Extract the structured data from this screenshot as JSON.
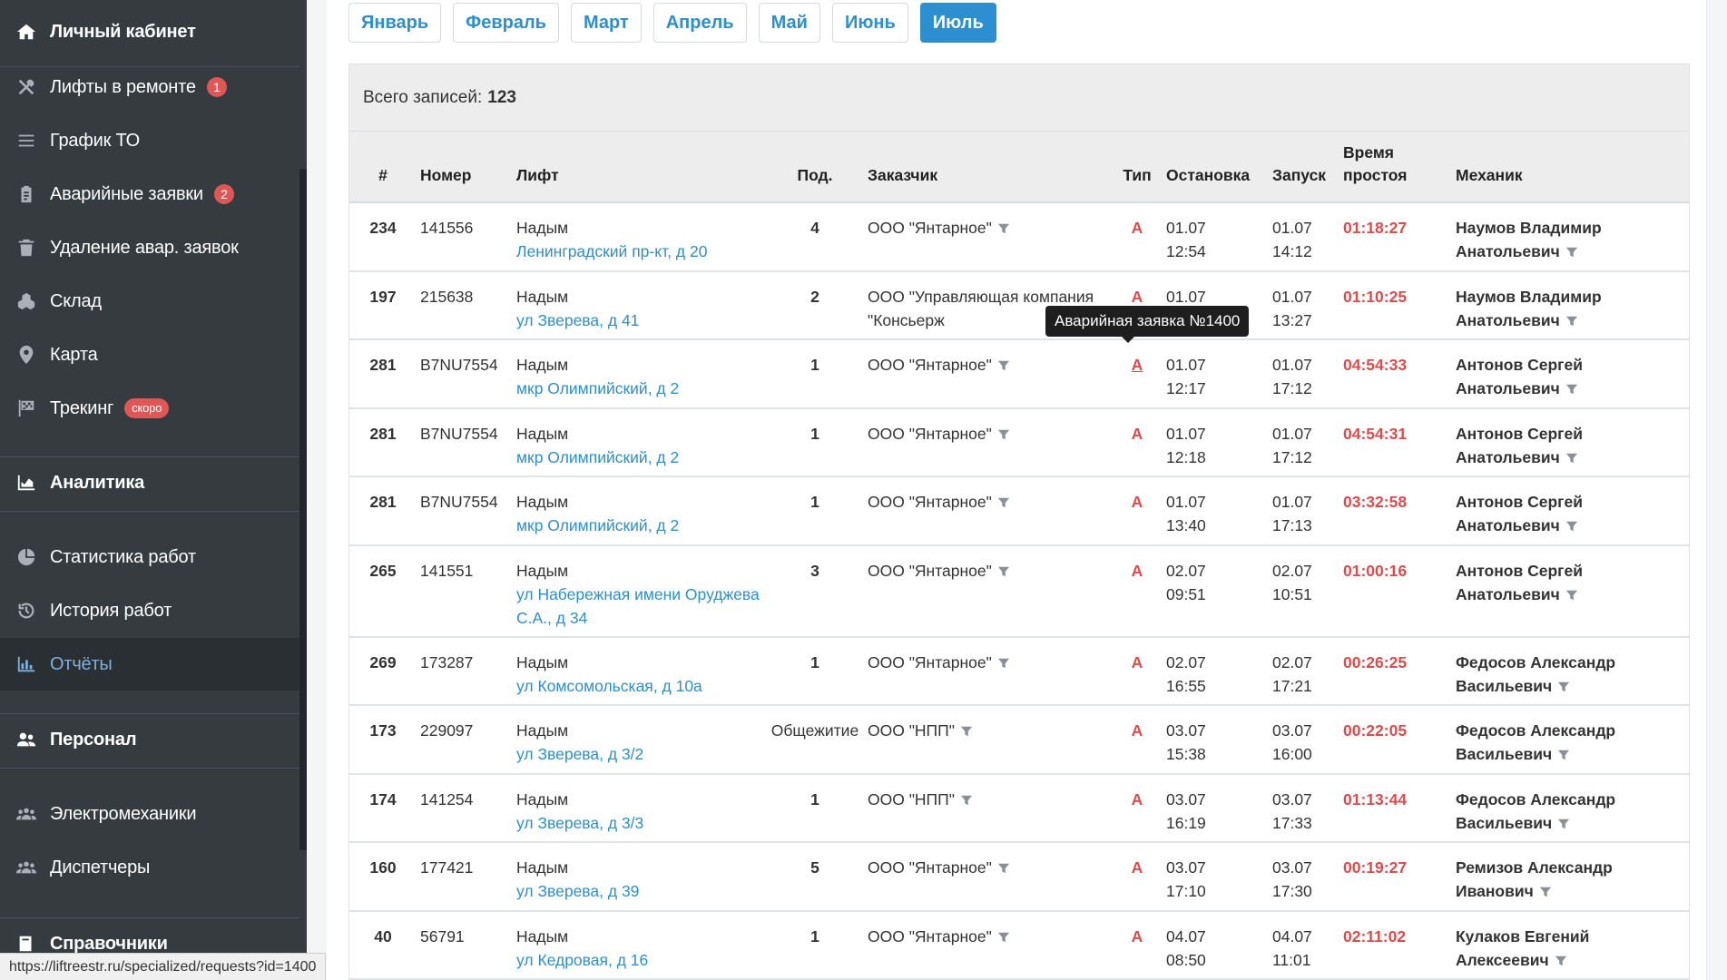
{
  "sidebar": {
    "title": "Личный кабинет",
    "items": [
      {
        "label": "Лифты в ремонте",
        "badge": "1"
      },
      {
        "label": "График ТО"
      },
      {
        "label": "Аварийные заявки",
        "badge": "2"
      },
      {
        "label": "Удаление авар. заявок"
      },
      {
        "label": "Склад"
      },
      {
        "label": "Карта"
      },
      {
        "label": "Трекинг",
        "badge": "скоро"
      }
    ],
    "analytics_header": "Аналитика",
    "analytics_items": [
      {
        "label": "Статистика работ"
      },
      {
        "label": "История работ"
      },
      {
        "label": "Отчёты"
      }
    ],
    "personnel_header": "Персонал",
    "personnel_items": [
      {
        "label": "Электромеханики"
      },
      {
        "label": "Диспетчеры"
      }
    ],
    "reference_header": "Справочники"
  },
  "months": [
    "Январь",
    "Февраль",
    "Март",
    "Апрель",
    "Май",
    "Июнь",
    "Июль"
  ],
  "active_month": "Июль",
  "summary": {
    "label": "Всего записей:",
    "count": "123"
  },
  "table": {
    "headers": {
      "idx": "#",
      "num": "Номер",
      "lift": "Лифт",
      "pod": "Под.",
      "cust": "Заказчик",
      "type": "Тип",
      "stop": "Остановка",
      "start": "Запуск",
      "down1": "Время",
      "down2": "простоя",
      "mech": "Механик"
    },
    "rows": [
      {
        "idx": "234",
        "num": "141556",
        "city": "Надым",
        "addr": "Ленинградский пр-кт, д 20",
        "pod": "4",
        "cust": "ООО \"Янтарное\"",
        "type": "А",
        "stop_d": "01.07",
        "stop_t": "12:54",
        "start_d": "01.07",
        "start_t": "14:12",
        "down": "01:18:27",
        "mech1": "Наумов Владимир",
        "mech2": "Анатольевич"
      },
      {
        "idx": "197",
        "num": "215638",
        "city": "Надым",
        "addr": "ул Зверева, д 41",
        "pod": "2",
        "cust": "ООО \"Управляющая компания \"Консьерж",
        "type": "А",
        "stop_d": "01.07",
        "stop_t": "",
        "start_d": "01.07",
        "start_t": "13:27",
        "down": "01:10:25",
        "mech1": "Наумов Владимир",
        "mech2": "Анатольевич"
      },
      {
        "idx": "281",
        "num": "B7NU7554",
        "city": "Надым",
        "addr": "мкр Олимпийский, д 2",
        "pod": "1",
        "cust": "ООО \"Янтарное\"",
        "type": "А",
        "stop_d": "01.07",
        "stop_t": "12:17",
        "start_d": "01.07",
        "start_t": "17:12",
        "down": "04:54:33",
        "mech1": "Антонов Сергей",
        "mech2": "Анатольевич"
      },
      {
        "idx": "281",
        "num": "B7NU7554",
        "city": "Надым",
        "addr": "мкр Олимпийский, д 2",
        "pod": "1",
        "cust": "ООО \"Янтарное\"",
        "type": "А",
        "stop_d": "01.07",
        "stop_t": "12:18",
        "start_d": "01.07",
        "start_t": "17:12",
        "down": "04:54:31",
        "mech1": "Антонов Сергей",
        "mech2": "Анатольевич"
      },
      {
        "idx": "281",
        "num": "B7NU7554",
        "city": "Надым",
        "addr": "мкр Олимпийский, д 2",
        "pod": "1",
        "cust": "ООО \"Янтарное\"",
        "type": "А",
        "stop_d": "01.07",
        "stop_t": "13:40",
        "start_d": "01.07",
        "start_t": "17:13",
        "down": "03:32:58",
        "mech1": "Антонов Сергей",
        "mech2": "Анатольевич"
      },
      {
        "idx": "265",
        "num": "141551",
        "city": "Надым",
        "addr": "ул Набережная имени Оруджева С.А., д 34",
        "pod": "3",
        "cust": "ООО \"Янтарное\"",
        "type": "А",
        "stop_d": "02.07",
        "stop_t": "09:51",
        "start_d": "02.07",
        "start_t": "10:51",
        "down": "01:00:16",
        "mech1": "Антонов Сергей",
        "mech2": "Анатольевич"
      },
      {
        "idx": "269",
        "num": "173287",
        "city": "Надым",
        "addr": "ул Комсомольская, д 10а",
        "pod": "1",
        "cust": "ООО \"Янтарное\"",
        "type": "А",
        "stop_d": "02.07",
        "stop_t": "16:55",
        "start_d": "02.07",
        "start_t": "17:21",
        "down": "00:26:25",
        "mech1": "Федосов Александр",
        "mech2": "Васильевич"
      },
      {
        "idx": "173",
        "num": "229097",
        "city": "Надым",
        "addr": "ул Зверева, д 3/2",
        "pod": "Общежитие",
        "cust": "ООО \"НПП\"",
        "type": "А",
        "stop_d": "03.07",
        "stop_t": "15:38",
        "start_d": "03.07",
        "start_t": "16:00",
        "down": "00:22:05",
        "mech1": "Федосов Александр",
        "mech2": "Васильевич"
      },
      {
        "idx": "174",
        "num": "141254",
        "city": "Надым",
        "addr": "ул Зверева, д 3/3",
        "pod": "1",
        "cust": "ООО \"НПП\"",
        "type": "А",
        "stop_d": "03.07",
        "stop_t": "16:19",
        "start_d": "03.07",
        "start_t": "17:33",
        "down": "01:13:44",
        "mech1": "Федосов Александр",
        "mech2": "Васильевич"
      },
      {
        "idx": "160",
        "num": "177421",
        "city": "Надым",
        "addr": "ул Зверева, д 39",
        "pod": "5",
        "cust": "ООО \"Янтарное\"",
        "type": "А",
        "stop_d": "03.07",
        "stop_t": "17:10",
        "start_d": "03.07",
        "start_t": "17:30",
        "down": "00:19:27",
        "mech1": "Ремизов Александр",
        "mech2": "Иванович"
      },
      {
        "idx": "40",
        "num": "56791",
        "city": "Надым",
        "addr": "ул Кедровая, д 16",
        "pod": "1",
        "cust": "ООО \"Янтарное\"",
        "type": "А",
        "stop_d": "04.07",
        "stop_t": "08:50",
        "start_d": "04.07",
        "start_t": "11:01",
        "down": "02:11:02",
        "mech1": "Кулаков Евгений",
        "mech2": "Алексеевич"
      }
    ]
  },
  "tooltip": "Аварийная заявка №1400",
  "status_url": "https://liftreestr.ru/specialized/requests?id=1400",
  "colors": {
    "accent": "#2d8fcf",
    "danger": "#e04a4a",
    "sidebar": "#353b3f"
  }
}
